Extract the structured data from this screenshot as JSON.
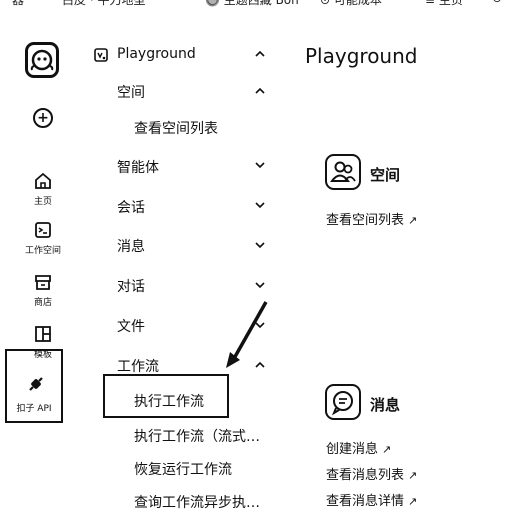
{
  "topbar": {
    "fragments": [
      "器",
      "白皮 · 平刀地型",
      "🔘 主题西藏 Bon",
      "⊙ 可能成本",
      "≡ 主页",
      "⊙"
    ]
  },
  "rail": {
    "items": [
      {
        "label": "主页",
        "icon": "home-icon"
      },
      {
        "label": "工作空间",
        "icon": "terminal-icon"
      },
      {
        "label": "商店",
        "icon": "store-icon"
      },
      {
        "label": "模板",
        "icon": "template-icon"
      },
      {
        "label": "扣子 API",
        "icon": "plugin-icon"
      }
    ]
  },
  "nav": {
    "section_title": "Playground",
    "items": [
      {
        "label": "空间",
        "chevron": "up"
      },
      {
        "label": "查看空间列表",
        "chevron": "none"
      },
      {
        "label": "智能体",
        "chevron": "down"
      },
      {
        "label": "会话",
        "chevron": "down"
      },
      {
        "label": "消息",
        "chevron": "down"
      },
      {
        "label": "对话",
        "chevron": "down"
      },
      {
        "label": "文件",
        "chevron": "down"
      },
      {
        "label": "工作流",
        "chevron": "up"
      },
      {
        "label": "执行工作流",
        "chevron": "none"
      },
      {
        "label": "执行工作流（流式…",
        "chevron": "none"
      },
      {
        "label": "恢复运行工作流",
        "chevron": "none"
      },
      {
        "label": "查询工作流异步执…",
        "chevron": "none"
      }
    ]
  },
  "main": {
    "title": "Playground",
    "cards": [
      {
        "title": "空间",
        "icon": "people-icon",
        "links": [
          "查看空间列表"
        ]
      },
      {
        "title": "消息",
        "icon": "chat-bubble-icon",
        "links": [
          "创建消息",
          "查看消息列表",
          "查看消息详情"
        ]
      }
    ]
  },
  "colors": {
    "text": "#111111",
    "background": "#ffffff"
  }
}
